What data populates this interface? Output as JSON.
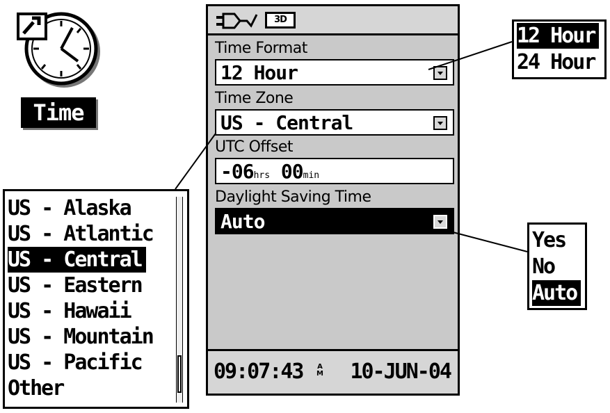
{
  "icon": {
    "label": "Time"
  },
  "status": {
    "signal_badge": "3D"
  },
  "fields": {
    "time_format": {
      "label": "Time Format",
      "value": "12 Hour"
    },
    "time_zone": {
      "label": "Time Zone",
      "value": "US - Central"
    },
    "utc_offset": {
      "label": "UTC Offset",
      "hours": "-06",
      "hours_unit": "hrs",
      "minutes": "00",
      "minutes_unit": "min"
    },
    "daylight_saving": {
      "label": "Daylight Saving Time",
      "value": "Auto"
    }
  },
  "bottom_bar": {
    "time": "09:07:43",
    "ampm_top": "A",
    "ampm_bottom": "M",
    "date": "10-JUN-04"
  },
  "time_format_options": [
    "12 Hour",
    "24 Hour"
  ],
  "time_format_selected": "12 Hour",
  "time_zone_options": [
    "US - Alaska",
    "US - Atlantic",
    "US - Central",
    "US - Eastern",
    "US - Hawaii",
    "US - Mountain",
    "US - Pacific",
    "Other"
  ],
  "time_zone_selected": "US - Central",
  "dst_options": [
    "Yes",
    "No",
    "Auto"
  ],
  "dst_selected": "Auto",
  "colors": {
    "screen_bg": "#c9c9c9",
    "highlight": "#000000"
  }
}
